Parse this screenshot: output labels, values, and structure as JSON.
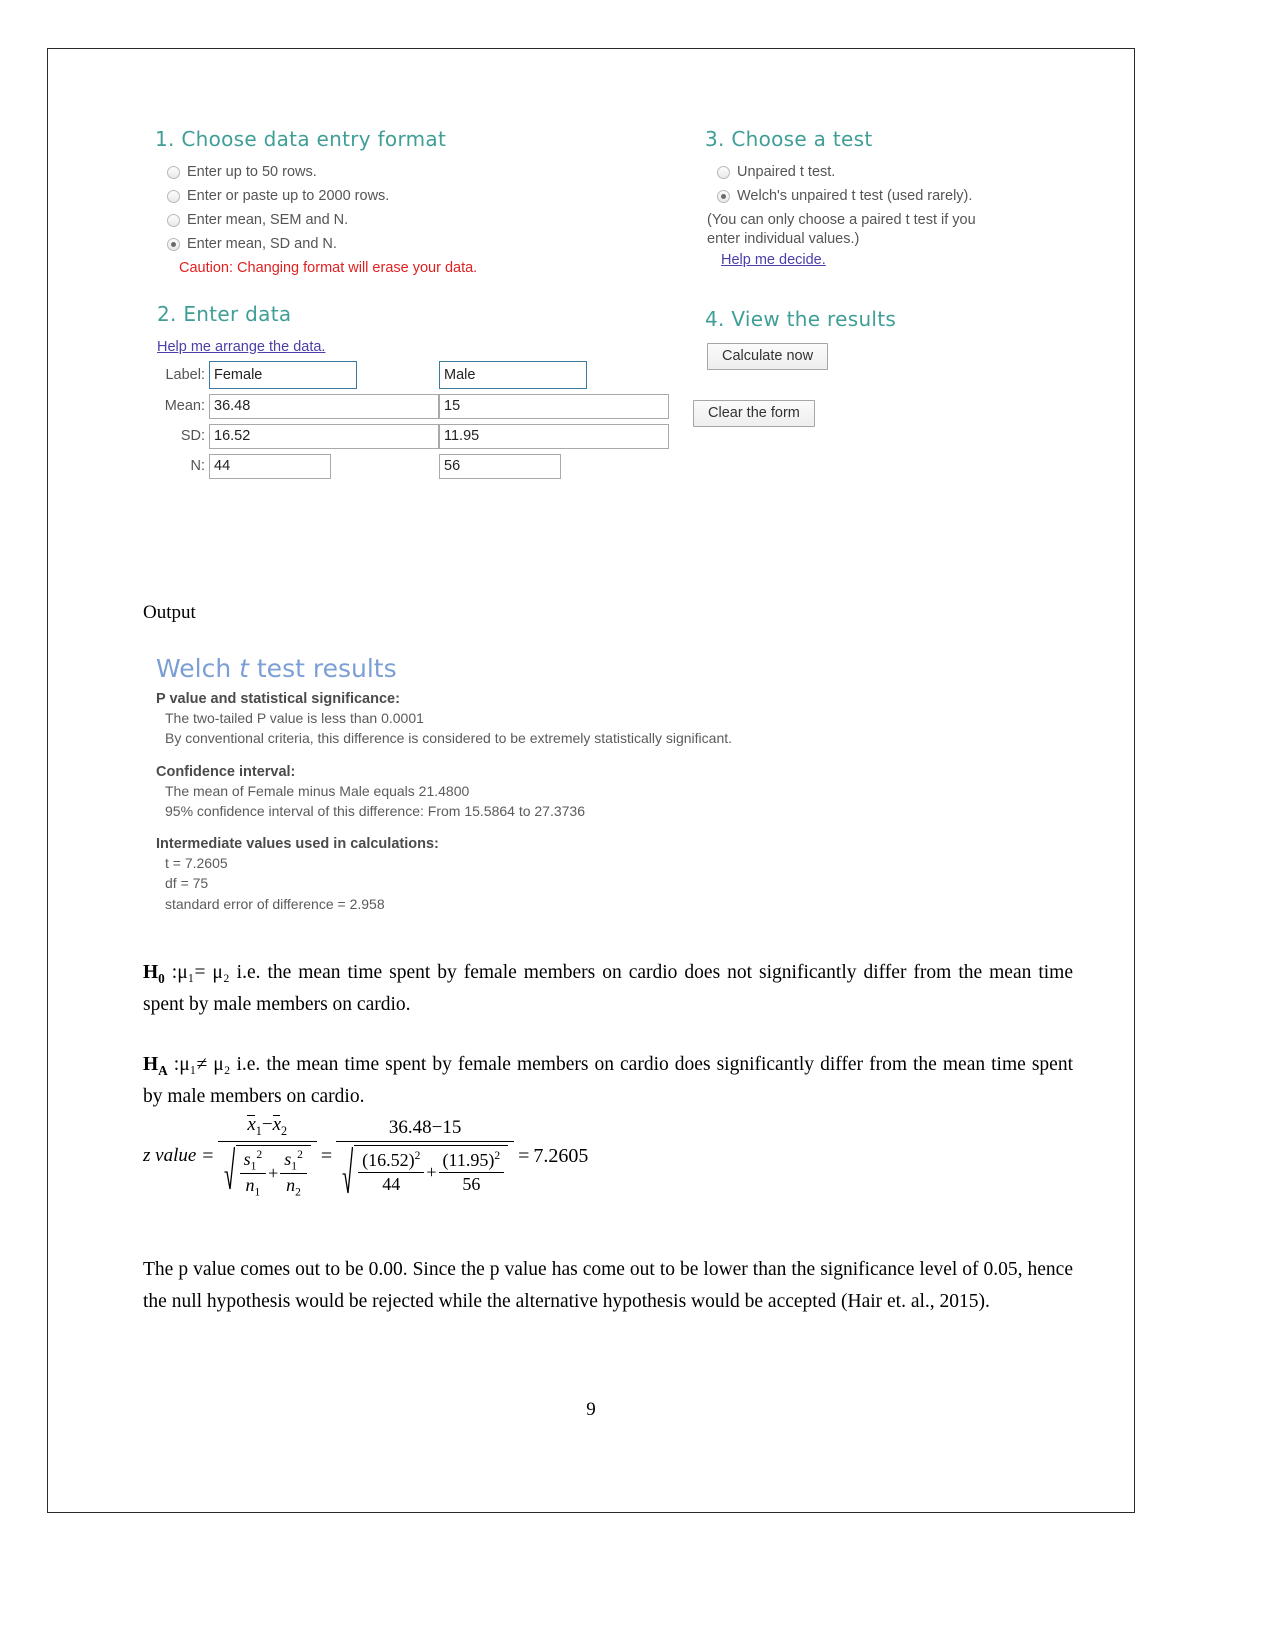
{
  "app": {
    "section1": {
      "heading": "1. Choose data entry format",
      "options": [
        {
          "label": "Enter up to 50 rows.",
          "selected": false
        },
        {
          "label": "Enter or paste up to 2000 rows.",
          "selected": false
        },
        {
          "label": "Enter mean, SEM and N.",
          "selected": false
        },
        {
          "label": "Enter mean, SD and N.",
          "selected": true
        }
      ],
      "caution": "Caution: Changing format will erase your data."
    },
    "section2": {
      "heading": "2. Enter data",
      "help_link": "Help me arrange the data.",
      "rows": [
        {
          "label": "Label:",
          "group1": "Female",
          "group2": "Male"
        },
        {
          "label": "Mean:",
          "group1": "36.48",
          "group2": "15"
        },
        {
          "label": "SD:",
          "group1": "16.52",
          "group2": "11.95"
        },
        {
          "label": "N:",
          "group1": "44",
          "group2": "56"
        }
      ]
    },
    "section3": {
      "heading": "3. Choose a test",
      "options": [
        {
          "label": "Unpaired t test.",
          "selected": false
        },
        {
          "label": "Welch's unpaired t test (used rarely).",
          "selected": true
        }
      ],
      "note_line1": "(You can only choose a paired t test if you",
      "note_line2": "enter individual values.)",
      "help_link": "Help me decide."
    },
    "section4": {
      "heading": "4. View the results",
      "calculate_button": "Calculate now",
      "clear_button": "Clear the form"
    },
    "colors": {
      "heading_teal": "#3f9e96",
      "caution_red": "#e02020",
      "link_purple": "#4a3fa8",
      "results_blue": "#7b9fd4"
    }
  },
  "output_label": "Output",
  "results": {
    "title_prefix": "Welch ",
    "title_italic": "t",
    "title_suffix": " test results",
    "blocks": [
      {
        "heading": "P value and statistical significance:",
        "lines": [
          "The two-tailed P value is less than 0.0001",
          "By conventional criteria, this difference is considered to be extremely statistically significant."
        ]
      },
      {
        "heading": "Confidence interval:",
        "lines": [
          "The mean of Female minus Male equals 21.4800",
          "95% confidence interval of this difference: From 15.5864 to 27.3736"
        ]
      },
      {
        "heading": "Intermediate values used in calculations:",
        "lines": [
          "t = 7.2605",
          "df = 75",
          "standard error of difference = 2.958"
        ]
      }
    ]
  },
  "hypotheses": {
    "null": {
      "symbol_main": "H",
      "symbol_sub": "0",
      "statement": " :μ₁= μ₂ i.e. the mean time spent by female members on cardio does not significantly differ from the mean time spent by male members on cardio."
    },
    "alt": {
      "symbol_main": "H",
      "symbol_sub": "A",
      "statement": " :μ₁≠ μ₂ i.e. the mean time spent by female members on cardio does significantly differ from the mean time spent by male members on cardio."
    }
  },
  "formula": {
    "label": "z value",
    "eq1": "=",
    "eq2": "=",
    "eq3": "=",
    "symbolic": {
      "numerator_x1": "x",
      "numerator_sub1": "1",
      "minus": "−",
      "numerator_x2": "x",
      "numerator_sub2": "2",
      "term1_num_s": "s",
      "term1_num_sub": "1",
      "term1_num_sup": "2",
      "term1_den_n": "n",
      "term1_den_sub": "1",
      "plus": "+",
      "term2_num_s": "s",
      "term2_num_sub": "1",
      "term2_num_sup": "2",
      "term2_den_n": "n",
      "term2_den_sub": "2"
    },
    "numeric": {
      "numerator": "36.48−15",
      "term1_num": "(16.52)",
      "term1_sup": "2",
      "term1_den": "44",
      "plus": "+",
      "term2_num": "(11.95)",
      "term2_sup": "2",
      "term2_den": "56"
    },
    "result": "7.2605"
  },
  "conclusion": "The p value comes out to be 0.00. Since the p value has come out to be lower than the significance level of 0.05, hence the null hypothesis would be rejected while the alternative hypothesis would be accepted (Hair et. al., 2015).",
  "page_number": "9"
}
